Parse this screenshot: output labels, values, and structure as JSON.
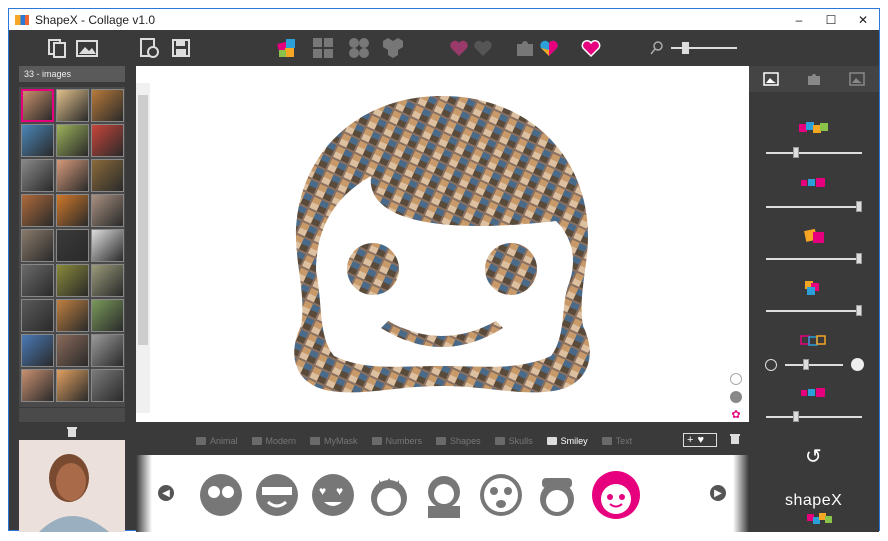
{
  "window": {
    "title": "ShapeX - Collage v1.0",
    "min": "–",
    "max": "☐",
    "close": "✕"
  },
  "left": {
    "image_count_label": "33 - images",
    "thumb_colors": [
      "#c98f6a",
      "#e0c08a",
      "#b87a3a",
      "#4a86b8",
      "#9cb25a",
      "#c8453a",
      "#888",
      "#d69a7a",
      "#8a6a3a",
      "#b06a3a",
      "#d0782a",
      "#a89080",
      "#8a7a6a",
      "#3a3a3a",
      "#ddd",
      "#6a6a6a",
      "#8a8a3a",
      "#9a9a7a",
      "#5a5a5a",
      "#c08040",
      "#7a9a5a",
      "#4a7ab8",
      "#8a6a5a",
      "#9a9a9a",
      "#c89070",
      "#e0a060",
      "#7a7a7a"
    ]
  },
  "categories": [
    {
      "label": "Animal",
      "active": false
    },
    {
      "label": "Modern",
      "active": false
    },
    {
      "label": "MyMask",
      "active": false
    },
    {
      "label": "Numbers",
      "active": false
    },
    {
      "label": "Shapes",
      "active": false
    },
    {
      "label": "Skulls",
      "active": false
    },
    {
      "label": "Smiley",
      "active": true
    },
    {
      "label": "Text",
      "active": false
    }
  ],
  "zoom": {
    "level": 0.18
  },
  "sliders": [
    {
      "value": 0.3
    },
    {
      "value": 1.0
    },
    {
      "value": 1.0
    },
    {
      "value": 1.0
    },
    {
      "value": 0.35
    },
    {
      "value": 0.3
    }
  ],
  "brand": "shapeX",
  "colors": {
    "accent": "#e6007e",
    "bg": "#3a3a3a"
  }
}
